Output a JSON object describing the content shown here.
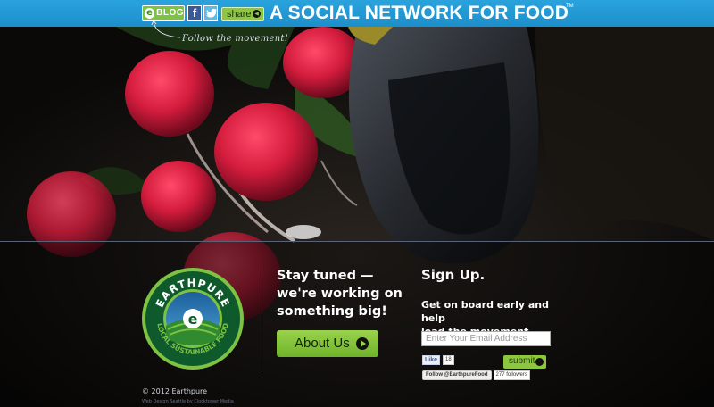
{
  "header": {
    "blog_letter": "e",
    "blog_label": "BLOG",
    "facebook_letter": "f",
    "share_label": "share",
    "tagline": "A SOCIAL NETWORK FOR FOOD",
    "trademark": "TM",
    "follow_text": "Follow the movement!"
  },
  "logo": {
    "brand": "EARTHPURE",
    "slogan": "LOCAL SUSTAINABLE FOOD",
    "center_letter": "e"
  },
  "main": {
    "stay_line1": "Stay tuned —",
    "stay_line2": "we're working on",
    "stay_line3": "something big!",
    "about_label": "About Us"
  },
  "signup": {
    "title": "Sign Up.",
    "desc_line1": "Get on board early and help",
    "desc_line2": "lead the movement.",
    "email_placeholder": "Enter Your Email Address",
    "submit_label": "submit",
    "fb_like_label": "Like",
    "fb_like_count": "18",
    "twitter_follow_label": "Follow @EarthpureFood",
    "twitter_followers": "277 followers"
  },
  "footer": {
    "copyright": "© 2012 Earthpure",
    "credit": "Web Design Seattle by Clocktower Media"
  },
  "colors": {
    "topbar": "#1c8fcb",
    "accent_green": "#8dc63f",
    "logo_ring": "#0f5a2c",
    "logo_ring_light": "#7dc242"
  },
  "icons": {
    "blog": "e-blog-icon",
    "facebook": "facebook-icon",
    "twitter": "twitter-bird-icon",
    "share_arrow": "play-circle-icon"
  }
}
